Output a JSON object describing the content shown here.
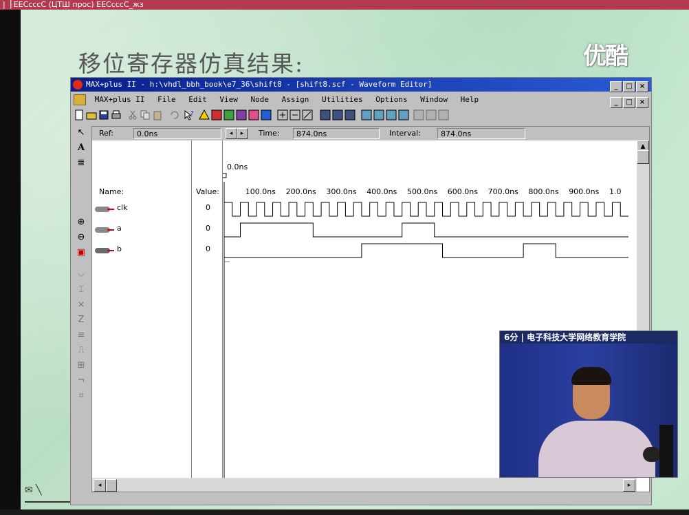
{
  "top_strip_text": "|▕ EEСсссС (ЦТШ прос) EEСсссС_жз",
  "slide": {
    "title": "移位寄存器仿真结果:",
    "logo": "优酷"
  },
  "window": {
    "title": "MAX+plus II - h:\\vhdl_bbh_book\\e7_36\\shift8 - [shift8.scf - Waveform Editor]",
    "buttons": [
      "_",
      "□",
      "×"
    ],
    "menu": [
      "MAX+plus II",
      "File",
      "Edit",
      "View",
      "Node",
      "Assign",
      "Utilities",
      "Options",
      "Window",
      "Help"
    ]
  },
  "editor": {
    "ref_label": "Ref:",
    "ref_value": "0.0ns",
    "time_label": "Time:",
    "time_value": "874.0ns",
    "interval_label": "Interval:",
    "interval_value": "874.0ns",
    "cursor_time": "0.0ns",
    "names_header": "Name:",
    "value_header": "Value:",
    "ticks": [
      "100.0ns",
      "200.0ns",
      "300.0ns",
      "400.0ns",
      "500.0ns",
      "600.0ns",
      "700.0ns",
      "800.0ns",
      "900.0ns",
      "1.0"
    ],
    "signals": [
      {
        "name": "clk",
        "value": "0"
      },
      {
        "name": "a",
        "value": "0"
      },
      {
        "name": "b",
        "value": "0"
      }
    ]
  },
  "waveforms": {
    "time_max_ns": 1000,
    "clk_period_ns": 40,
    "a_high": [
      [
        40,
        220
      ],
      [
        440,
        520
      ]
    ],
    "b_high": [
      [
        340,
        540
      ],
      [
        740,
        820
      ]
    ]
  },
  "video": {
    "caption": "6分 | 电子科技大学网络教育学院"
  }
}
